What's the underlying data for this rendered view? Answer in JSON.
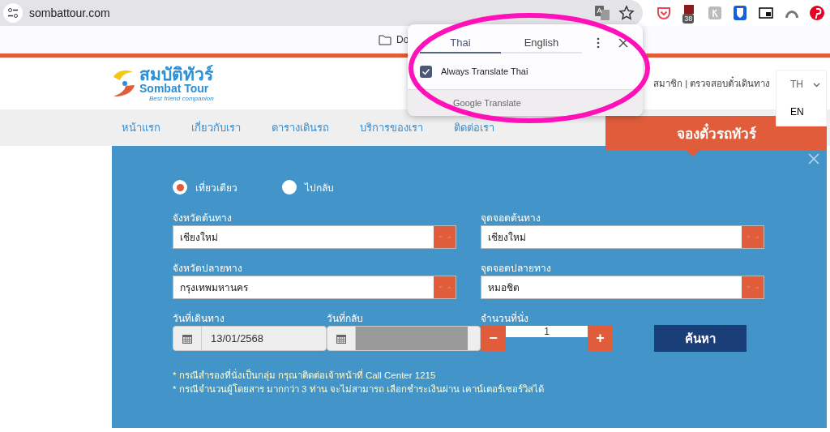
{
  "browser": {
    "url": "sombattour.com",
    "bookmarks": [
      {
        "label": "Do"
      }
    ],
    "extension_badge": "38"
  },
  "translate_popup": {
    "tabs": [
      {
        "label": "Thai",
        "selected": true
      },
      {
        "label": "English",
        "selected": false
      }
    ],
    "checkbox": {
      "label": "Always Translate Thai",
      "checked": true
    },
    "footer": "Google Translate"
  },
  "site": {
    "logo": {
      "thai": "สมบัติทัวร์",
      "name": "Sombat Tour",
      "tagline": "Best friend companion"
    },
    "top_links": "สมาชิก | ตรวจสอบตั๋วเดินทาง",
    "languages": [
      {
        "label": "TH",
        "selected": true
      },
      {
        "label": "EN",
        "selected": false
      }
    ],
    "nav": [
      "หน้าแรก",
      "เกี่ยวกับเรา",
      "ตารางเดินรถ",
      "บริการของเรา",
      "ติดต่อเรา"
    ],
    "booking_tab": "จองตั๋วรถทัวร์"
  },
  "form": {
    "trip_types": [
      {
        "label": "เที่ยวเดียว",
        "selected": true
      },
      {
        "label": "ไปกลับ",
        "selected": false
      }
    ],
    "selects": [
      {
        "label": "จังหวัดต้นทาง",
        "value": "เชียงใหม่"
      },
      {
        "label": "จุดจอดต้นทาง",
        "value": "เชียงใหม่"
      },
      {
        "label": "จังหวัดปลายทาง",
        "value": "กรุงเทพมหานคร"
      },
      {
        "label": "จุดจอดปลายทาง",
        "value": "หมอชิต"
      }
    ],
    "depart_date": {
      "label": "วันที่เดินทาง",
      "value": "13/01/2568",
      "disabled": false
    },
    "return_date": {
      "label": "วันที่กลับ",
      "disabled": true
    },
    "seats": {
      "label": "จำนวนที่นั่ง",
      "value": "1",
      "minus": "−",
      "plus": "+"
    },
    "search_button": "ค้นหา",
    "notes": [
      "* กรณีสำรองที่นั่งเป็นกลุ่ม กรุณาติดต่อเจ้าหน้าที่ Call Center 1215",
      "* กรณีจำนวนผู้โดยสาร มากกว่า 3 ท่าน จะไม่สามารถ เลือกชำระเงินผ่าน เคาน์เตอร์เซอร์วิสได้"
    ]
  }
}
